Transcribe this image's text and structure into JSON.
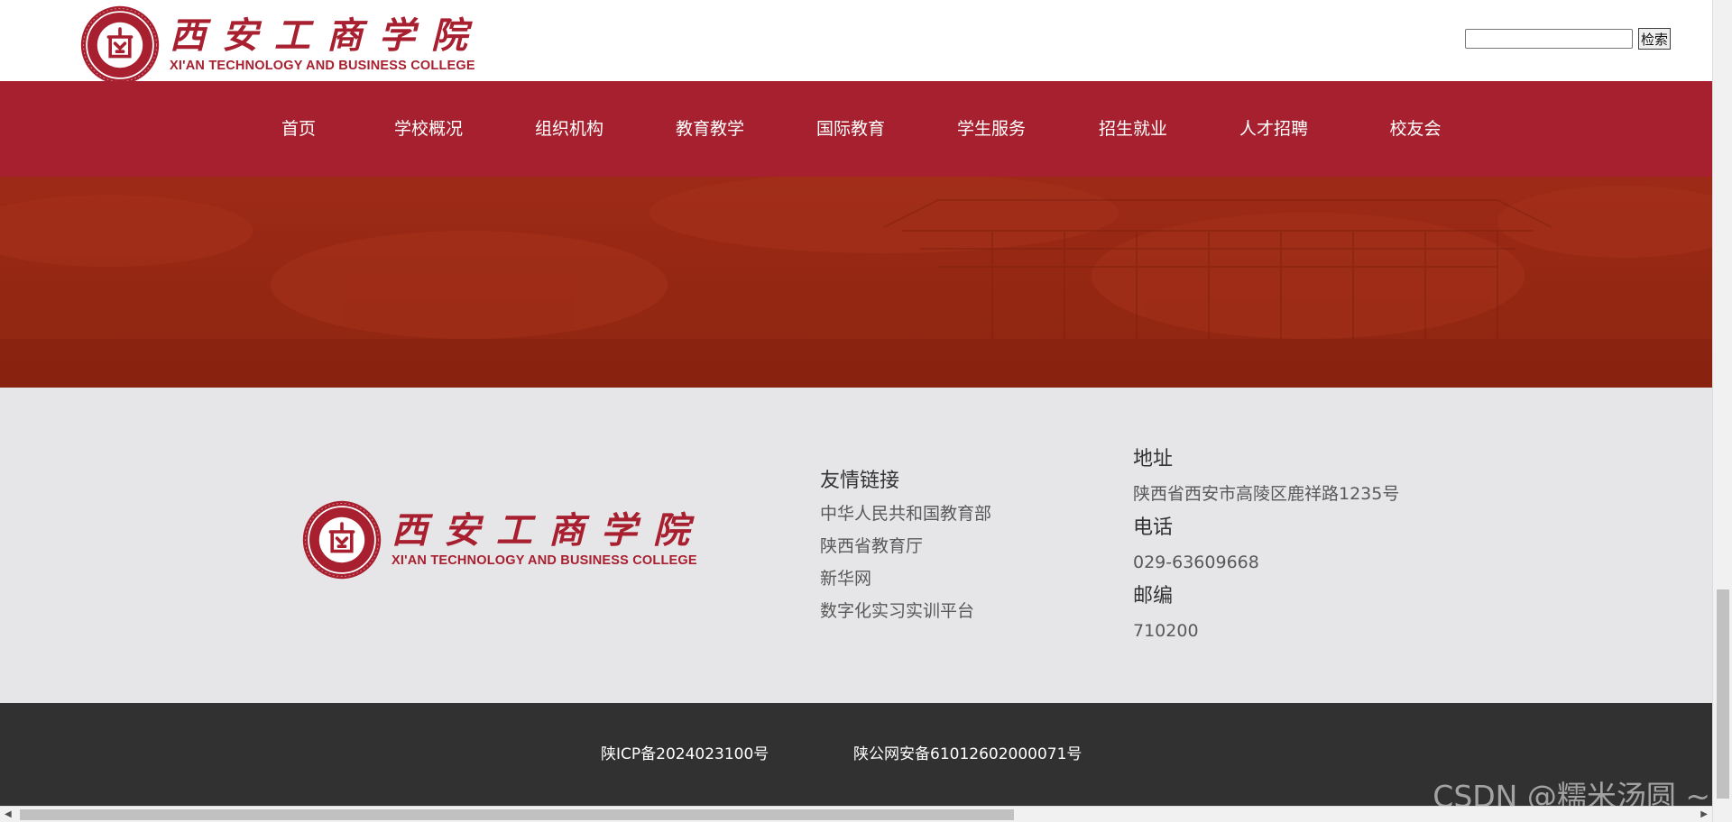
{
  "header": {
    "logo": {
      "cn_name": "西安工商学院",
      "en_name": "XI'AN TECHNOLOGY AND BUSINESS COLLEGE"
    },
    "search": {
      "value": "",
      "button_label": "检索"
    }
  },
  "nav": {
    "items": [
      {
        "label": "首页"
      },
      {
        "label": "学校概况"
      },
      {
        "label": "组织机构"
      },
      {
        "label": "教育教学"
      },
      {
        "label": "国际教育"
      },
      {
        "label": "学生服务"
      },
      {
        "label": "招生就业"
      },
      {
        "label": "人才招聘"
      },
      {
        "label": "校友会"
      }
    ]
  },
  "footer": {
    "links": {
      "title": "友情链接",
      "items": [
        {
          "label": "中华人民共和国教育部"
        },
        {
          "label": "陕西省教育厅"
        },
        {
          "label": "新华网"
        },
        {
          "label": "数字化实习实训平台"
        }
      ]
    },
    "contact": {
      "address_label": "地址",
      "address_value": "陕西省西安市高陵区鹿祥路1235号",
      "phone_label": "电话",
      "phone_value": "029-63609668",
      "postcode_label": "邮编",
      "postcode_value": "710200"
    },
    "bottom": {
      "icp": "陕ICP备2024023100号",
      "police": "陕公网安备61012602000071号"
    }
  },
  "watermark": "CSDN @糯米汤圆 ~",
  "colors": {
    "brand_red": "#a6202f",
    "banner": "#932712",
    "info_bg": "#e6e6e8",
    "bottom_bg": "#313132"
  },
  "icons": {
    "seal": "college-seal-icon"
  }
}
